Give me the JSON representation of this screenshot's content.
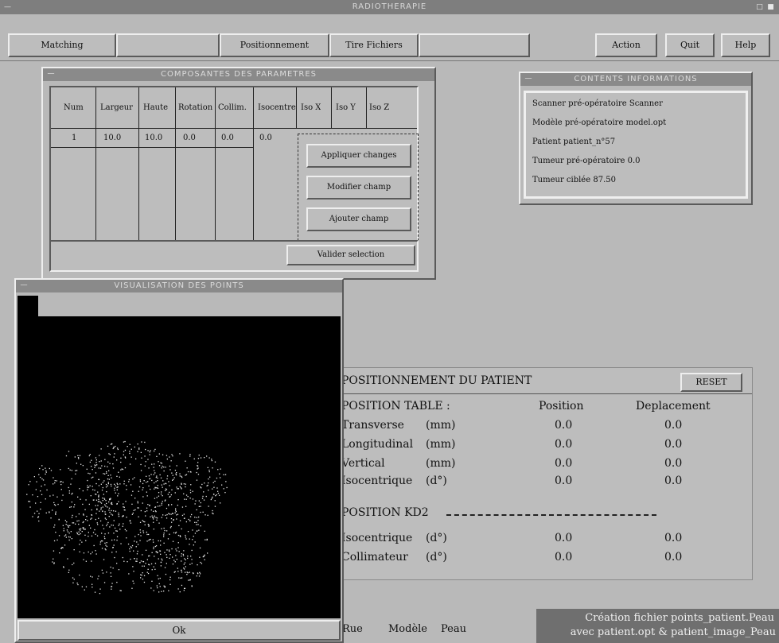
{
  "app": {
    "title": "RADIOTHERAPIE"
  },
  "toolbar": {
    "buttons": [
      "Matching",
      "",
      "Positionnement",
      "Tire Fichiers",
      "",
      "Action",
      "Quit",
      "Help"
    ]
  },
  "table_window": {
    "title": "COMPOSANTES DES PARAMETRES",
    "headers": [
      "Num",
      "Largeur",
      "Haute",
      "Rotation",
      "Collim.",
      "Isocentre",
      "Iso X",
      "Iso Y",
      "Iso Z"
    ],
    "row": [
      "1",
      "10.0",
      "10.0",
      "0.0",
      "0.0",
      "0.0"
    ],
    "buttons": [
      "Appliquer changes",
      "Modifier champ",
      "Ajouter champ"
    ],
    "validate_button": "Valider selection"
  },
  "contents_window": {
    "title": "CONTENTS INFORMATIONS",
    "lines": [
      {
        "label": "Scanner pré-opératoire",
        "value": "Scanner"
      },
      {
        "label": "Modèle pré-opératoire",
        "value": "model.opt"
      },
      {
        "label": "Patient",
        "value": "patient_n°57"
      },
      {
        "label": "Tumeur pré-opératoire",
        "value": "0.0"
      },
      {
        "label": "Tumeur ciblée",
        "value": "87.50"
      }
    ]
  },
  "viewer_window": {
    "title": "VISUALISATION DES POINTS",
    "status": "Ok"
  },
  "positioning": {
    "title": "POSITIONNEMENT DU PATIENT",
    "reset_button": "RESET",
    "table_header": "POSITION TABLE :",
    "col_position": "Position",
    "col_deplacement": "Deplacement",
    "rows": [
      {
        "label": "Transverse",
        "unit": "(mm)",
        "position": "0.0",
        "deplacement": "0.0"
      },
      {
        "label": "Longitudinal",
        "unit": "(mm)",
        "position": "0.0",
        "deplacement": "0.0"
      },
      {
        "label": "Vertical",
        "unit": "(mm)",
        "position": "0.0",
        "deplacement": "0.0"
      },
      {
        "label": "Isocentrique",
        "unit": "(d°)",
        "position": "0.0",
        "deplacement": "0.0"
      }
    ],
    "kd2_header": "POSITION KD2",
    "kd2_rows": [
      {
        "label": "Isocentrique",
        "unit": "(d°)",
        "position": "0.0",
        "deplacement": "0.0"
      },
      {
        "label": "Collimateur",
        "unit": "(d°)",
        "position": "0.0",
        "deplacement": "0.0"
      }
    ]
  },
  "bottom_bar": {
    "labels": [
      "Rue",
      "Modèle",
      "Peau"
    ],
    "message_line1": "Création fichier points_patient.Peau",
    "message_line2": "avec patient.opt & patient_image_Peau"
  }
}
